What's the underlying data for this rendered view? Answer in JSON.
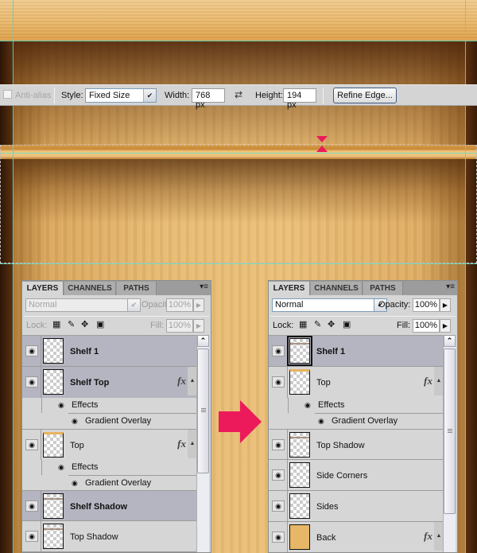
{
  "options_bar": {
    "anti_alias_label": "Anti-alias",
    "style_label": "Style:",
    "style_value": "Fixed Size",
    "width_label": "Width:",
    "width_value": "768 px",
    "swap_icon": "swap-arrows-icon",
    "height_label": "Height:",
    "height_value": "194 px",
    "refine_edge_label": "Refine Edge..."
  },
  "colors": {
    "accent": "#ec1a5a",
    "guide": "#4fd3d1",
    "selected_row": "#b4b5c0",
    "panel_bg": "#d6d6d6"
  },
  "panel_before": {
    "tabs": [
      "LAYERS",
      "CHANNELS",
      "PATHS"
    ],
    "blend_mode": "Normal",
    "opacity_label": "Opacity:",
    "opacity_value": "100%",
    "lock_label": "Lock:",
    "fill_label": "Fill:",
    "fill_value": "100%",
    "layers": [
      {
        "name": "Shelf 1",
        "bold": true,
        "selected": true
      },
      {
        "name": "Shelf Top",
        "bold": true,
        "selected": true,
        "fx": "fx",
        "effects_label": "Effects",
        "effect": "Gradient Overlay"
      },
      {
        "name": "Top",
        "bold": false,
        "selected": false,
        "fx": "fx",
        "effects_label": "Effects",
        "effect": "Gradient Overlay"
      },
      {
        "name": "Shelf Shadow",
        "bold": true,
        "selected": true
      },
      {
        "name": "Top Shadow",
        "bold": false,
        "selected": false
      }
    ]
  },
  "panel_after": {
    "tabs": [
      "LAYERS",
      "CHANNELS",
      "PATHS"
    ],
    "blend_mode": "Normal",
    "opacity_label": "Opacity:",
    "opacity_value": "100%",
    "lock_label": "Lock:",
    "fill_label": "Fill:",
    "fill_value": "100%",
    "layers": [
      {
        "name": "Shelf 1",
        "bold": true,
        "selected": true
      },
      {
        "name": "Top",
        "bold": false,
        "selected": false,
        "fx": "fx",
        "effects_label": "Effects",
        "effect": "Gradient Overlay"
      },
      {
        "name": "Top Shadow",
        "bold": false,
        "selected": false
      },
      {
        "name": "Side Corners",
        "bold": false,
        "selected": false
      },
      {
        "name": "Sides",
        "bold": false,
        "selected": false
      },
      {
        "name": "Back",
        "bold": false,
        "selected": false,
        "fx": "fx"
      }
    ]
  }
}
